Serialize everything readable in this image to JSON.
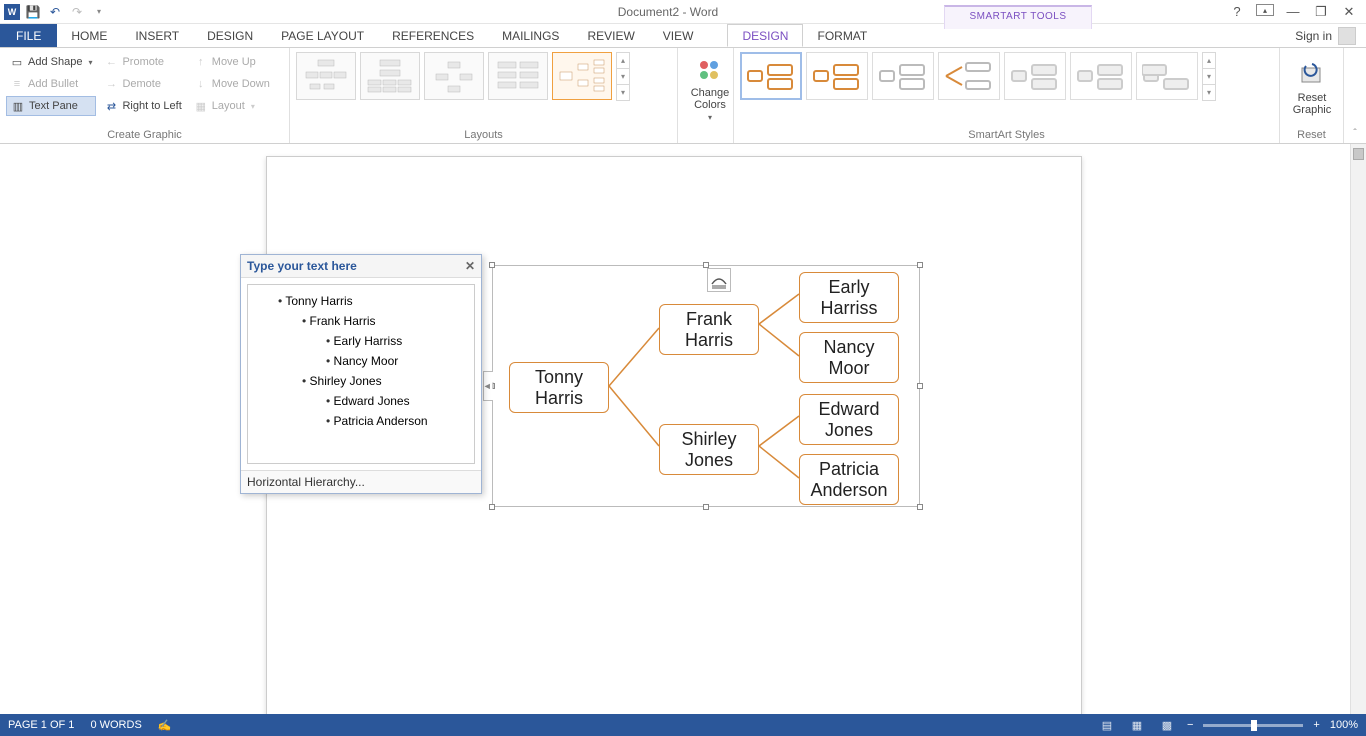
{
  "titlebar": {
    "doc_title": "Document2 - Word",
    "tool_context": "SMARTART TOOLS"
  },
  "tabs": {
    "file": "FILE",
    "items": [
      "HOME",
      "INSERT",
      "DESIGN",
      "PAGE LAYOUT",
      "REFERENCES",
      "MAILINGS",
      "REVIEW",
      "VIEW"
    ],
    "context": [
      "DESIGN",
      "FORMAT"
    ],
    "signin": "Sign in"
  },
  "ribbon": {
    "create_graphic": {
      "label": "Create Graphic",
      "add_shape": "Add Shape",
      "add_bullet": "Add Bullet",
      "text_pane": "Text Pane",
      "promote": "Promote",
      "demote": "Demote",
      "rtl": "Right to Left",
      "move_up": "Move Up",
      "move_down": "Move Down",
      "layout": "Layout"
    },
    "layouts": {
      "label": "Layouts"
    },
    "change_colors": {
      "label": "Change Colors"
    },
    "styles": {
      "label": "SmartArt Styles"
    },
    "reset": {
      "label": "Reset",
      "reset_graphic": "Reset Graphic"
    }
  },
  "textpane": {
    "header": "Type your text here",
    "footer": "Horizontal Hierarchy...",
    "items": [
      {
        "level": 1,
        "text": "Tonny Harris"
      },
      {
        "level": 2,
        "text": "Frank Harris"
      },
      {
        "level": 3,
        "text": "Early Harriss"
      },
      {
        "level": 3,
        "text": "Nancy Moor"
      },
      {
        "level": 2,
        "text": "Shirley Jones"
      },
      {
        "level": 3,
        "text": "Edward Jones"
      },
      {
        "level": 3,
        "text": "Patricia Anderson"
      }
    ]
  },
  "smartart": {
    "nodes": {
      "root": "Tonny Harris",
      "c1": "Frank Harris",
      "c2": "Shirley Jones",
      "g1": "Early Harriss",
      "g2": "Nancy Moor",
      "g3": "Edward Jones",
      "g4": "Patricia Anderson"
    }
  },
  "statusbar": {
    "page": "PAGE 1 OF 1",
    "words": "0 WORDS",
    "zoom": "100%"
  }
}
